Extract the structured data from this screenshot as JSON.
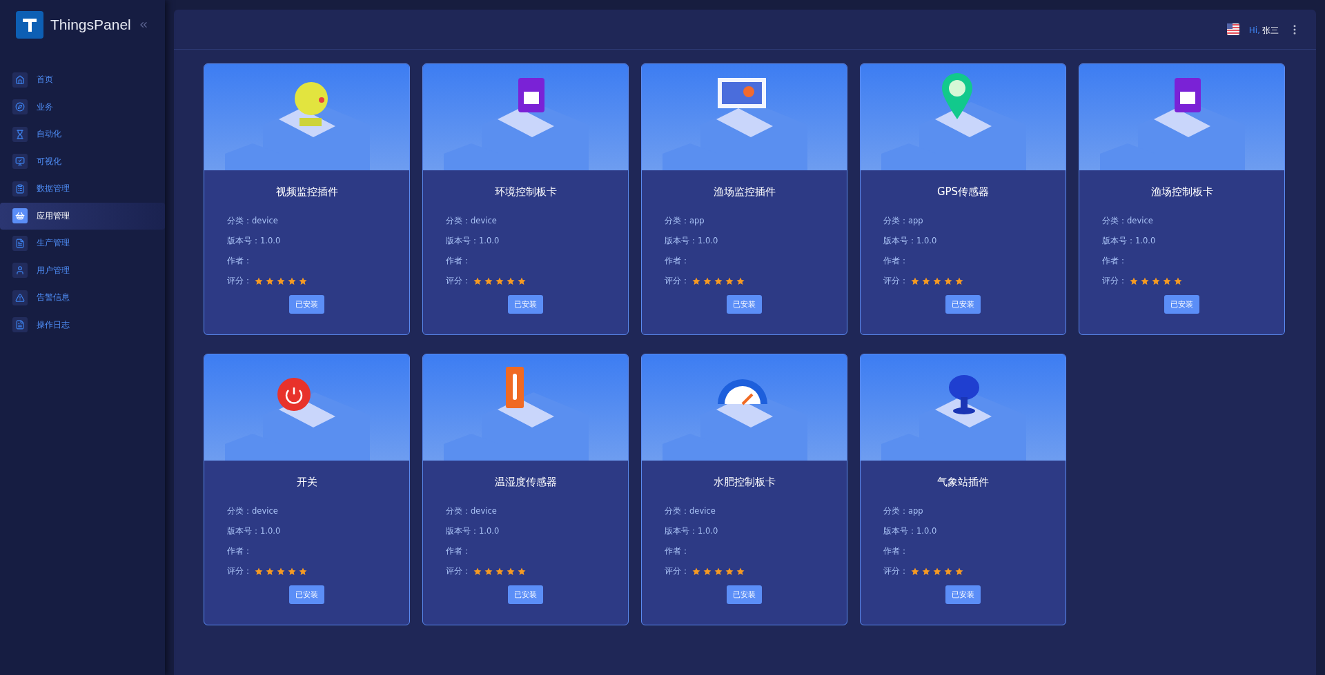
{
  "brand": {
    "name": "ThingsPanel"
  },
  "sidebar": {
    "items": [
      {
        "label": "首页",
        "selected": false
      },
      {
        "label": "业务",
        "selected": false
      },
      {
        "label": "自动化",
        "selected": false
      },
      {
        "label": "可视化",
        "selected": false
      },
      {
        "label": "数据管理",
        "selected": false
      },
      {
        "label": "应用管理",
        "selected": true
      },
      {
        "label": "生产管理",
        "selected": false
      },
      {
        "label": "用户管理",
        "selected": false
      },
      {
        "label": "告警信息",
        "selected": false
      },
      {
        "label": "操作日志",
        "selected": false
      }
    ]
  },
  "header": {
    "greeting": "Hi,",
    "user": "张三"
  },
  "cards": [
    {
      "kind": "camera",
      "title": "视频监控插件",
      "lines": [
        "分类：device",
        "版本号：1.0.0",
        "作者："
      ],
      "rating_label": "评分：",
      "stars": 5,
      "button": "已安装"
    },
    {
      "kind": "board",
      "title": "环境控制板卡",
      "lines": [
        "分类：device",
        "版本号：1.0.0",
        "作者："
      ],
      "rating_label": "评分：",
      "stars": 5,
      "button": "已安装"
    },
    {
      "kind": "laptop",
      "title": "渔场监控插件",
      "lines": [
        "分类：app",
        "版本号：1.0.0",
        "作者："
      ],
      "rating_label": "评分：",
      "stars": 5,
      "button": "已安装"
    },
    {
      "kind": "pin",
      "title": "GPS传感器",
      "lines": [
        "分类：app",
        "版本号：1.0.0",
        "作者："
      ],
      "rating_label": "评分：",
      "stars": 5,
      "button": "已安装"
    },
    {
      "kind": "board",
      "title": "渔场控制板卡",
      "lines": [
        "分类：device",
        "版本号：1.0.0",
        "作者："
      ],
      "rating_label": "评分：",
      "stars": 5,
      "button": "已安装"
    },
    {
      "kind": "power",
      "title": "开关",
      "lines": [
        "分类：device",
        "版本号：1.0.0",
        "作者："
      ],
      "rating_label": "评分：",
      "stars": 5,
      "button": "已安装"
    },
    {
      "kind": "thermo",
      "title": "温湿度传感器",
      "lines": [
        "分类：device",
        "版本号：1.0.0",
        "作者："
      ],
      "rating_label": "评分：",
      "stars": 5,
      "button": "已安装"
    },
    {
      "kind": "gauge",
      "title": "水肥控制板卡",
      "lines": [
        "分类：device",
        "版本号：1.0.0",
        "作者："
      ],
      "rating_label": "评分：",
      "stars": 5,
      "button": "已安装"
    },
    {
      "kind": "dish",
      "title": "气象站插件",
      "lines": [
        "分类：app",
        "版本号：1.0.0",
        "作者："
      ],
      "rating_label": "评分：",
      "stars": 5,
      "button": "已安装"
    }
  ]
}
